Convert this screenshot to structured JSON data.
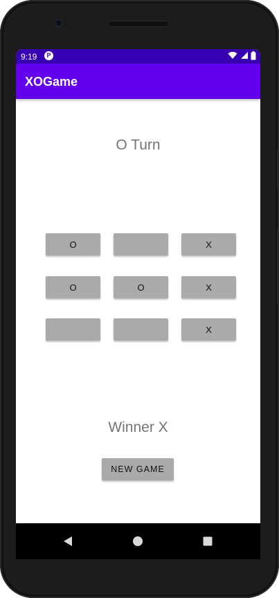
{
  "status_bar": {
    "time": "9:19",
    "notification_icon": "pico-p-icon",
    "background": "#3700b3"
  },
  "app_bar": {
    "title": "XOGame",
    "background": "#6200ee"
  },
  "turn_label": "O Turn",
  "board": {
    "cells": [
      [
        "O",
        "",
        "X"
      ],
      [
        "O",
        "O",
        "X"
      ],
      [
        "",
        "",
        "X"
      ]
    ],
    "cell_color": "#aaaaaa"
  },
  "winner_label": "Winner X",
  "new_game_button": "NEW GAME",
  "nav_bar": {
    "back_icon": "back-triangle-icon",
    "home_icon": "home-circle-icon",
    "recents_icon": "recents-square-icon"
  }
}
